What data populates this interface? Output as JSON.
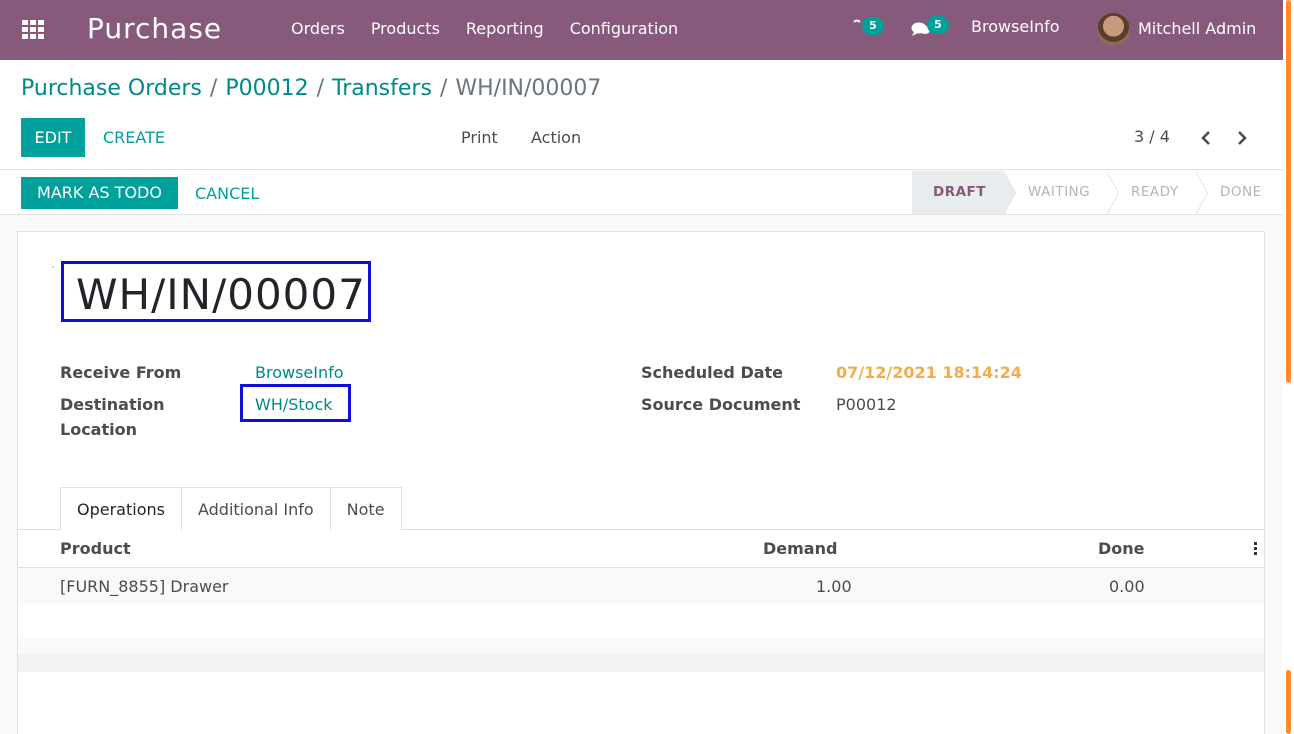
{
  "navbar": {
    "app_name": "Purchase",
    "menu": [
      "Orders",
      "Products",
      "Reporting",
      "Configuration"
    ],
    "activity_count": "5",
    "messages_count": "5",
    "company": "BrowseInfo",
    "user": "Mitchell Admin"
  },
  "breadcrumb": {
    "items": [
      "Purchase Orders",
      "P00012",
      "Transfers"
    ],
    "current": "WH/IN/00007"
  },
  "toolbar": {
    "edit": "EDIT",
    "create": "CREATE",
    "print": "Print",
    "action": "Action",
    "pager": "3 / 4"
  },
  "statusbar": {
    "mark_todo": "MARK AS TODO",
    "cancel": "CANCEL",
    "steps": [
      "DRAFT",
      "WAITING",
      "READY",
      "DONE"
    ],
    "active_step": "DRAFT"
  },
  "form": {
    "title": "WH/IN/00007",
    "receive_from_label": "Receive From",
    "receive_from": "BrowseInfo",
    "destination_label_1": "Destination",
    "destination_label_2": "Location",
    "destination": "WH/Stock",
    "scheduled_date_label": "Scheduled Date",
    "scheduled_date": "07/12/2021 18:14:24",
    "source_document_label": "Source Document",
    "source_document": "P00012"
  },
  "tabs": [
    "Operations",
    "Additional Info",
    "Note"
  ],
  "table": {
    "columns": [
      "Product",
      "Demand",
      "Done"
    ],
    "rows": [
      {
        "product": "[FURN_8855] Drawer",
        "demand": "1.00",
        "done": "0.00"
      }
    ]
  },
  "colors": {
    "navbar": "#875a7b",
    "accent": "#00a09d",
    "link": "#00898a",
    "date": "#f0ad4e",
    "highlight_box": "#1010d8"
  }
}
